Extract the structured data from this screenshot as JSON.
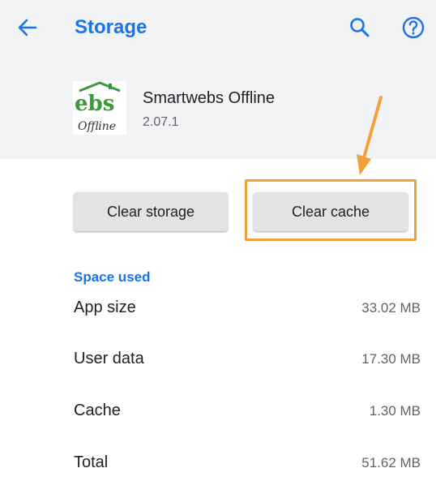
{
  "header": {
    "title": "Storage",
    "back_icon": "arrow-back-icon",
    "search_icon": "search-icon",
    "help_icon": "help-circle-icon",
    "accent": "#1a73e8",
    "background": "#f2f3f5"
  },
  "app": {
    "name": "Smartwebs Offline",
    "version": "2.07.1",
    "logo_text": "webs Offline"
  },
  "actions": {
    "clear_storage_label": "Clear storage",
    "clear_cache_label": "Clear cache",
    "highlight_color": "#f4a03a"
  },
  "space_used": {
    "section_label": "Space used",
    "rows": [
      {
        "label": "App size",
        "value": "33.02 MB"
      },
      {
        "label": "User data",
        "value": "17.30 MB"
      },
      {
        "label": "Cache",
        "value": "1.30 MB"
      },
      {
        "label": "Total",
        "value": "51.62 MB"
      }
    ]
  }
}
